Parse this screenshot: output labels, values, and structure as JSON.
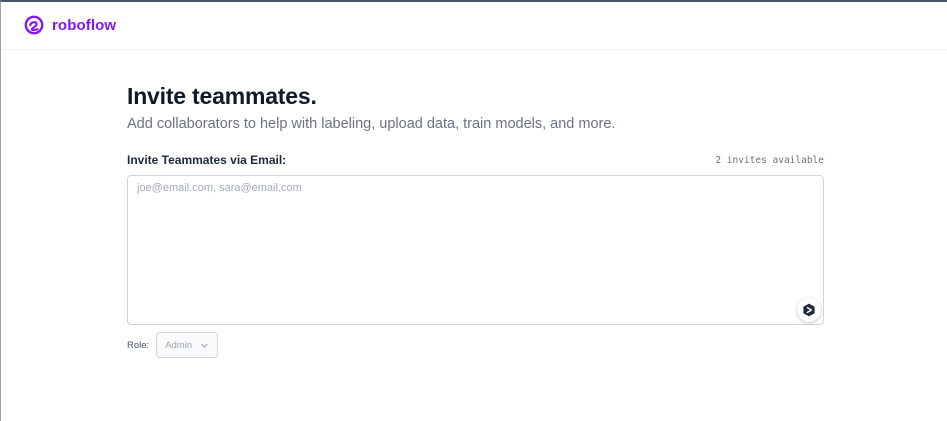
{
  "brand": {
    "name": "roboflow",
    "color": "#8315f9"
  },
  "page": {
    "title": "Invite teammates.",
    "subtitle": "Add collaborators to help with labeling, upload data, train models, and more."
  },
  "invite_form": {
    "email_label": "Invite Teammates via Email:",
    "invites_available": "2 invites available",
    "email_value": "",
    "email_placeholder": "joe@email.com, sara@email.com",
    "assist_icon": "extension-assistant-icon",
    "role_label": "Role:",
    "role_value": "Admin",
    "role_icon": "chevron-down-icon"
  }
}
